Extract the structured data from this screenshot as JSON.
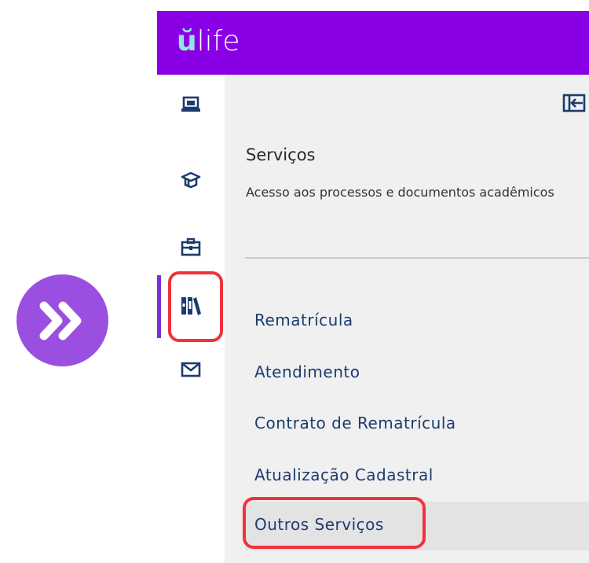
{
  "app": {
    "brand_letter": "ŭ",
    "brand_rest": "life"
  },
  "rail": {
    "items": [
      {
        "icon": "laptop-icon"
      },
      {
        "icon": "graduation-cap-icon"
      },
      {
        "icon": "briefcase-icon"
      },
      {
        "icon": "library-books-icon",
        "active": true
      },
      {
        "icon": "envelope-icon"
      }
    ]
  },
  "panel": {
    "title": "Serviços",
    "description": "Acesso aos processos e documentos acadêmicos",
    "menu": [
      {
        "label": "Rematrícula"
      },
      {
        "label": "Atendimento"
      },
      {
        "label": "Contrato de Rematrícula"
      },
      {
        "label": "Atualização Cadastral"
      },
      {
        "label": "Outros Serviços",
        "hovered": true
      }
    ]
  },
  "colors": {
    "brand": "#8a00e6",
    "accent_logo": "#8fe6e0",
    "highlight": "#f2323a",
    "badge": "#9a4fe0"
  }
}
